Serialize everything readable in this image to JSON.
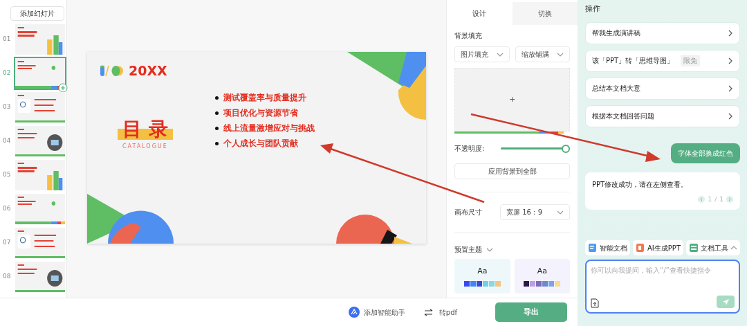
{
  "sidebar": {
    "add_button": "添加幻灯片",
    "slides": [
      {
        "number": "01",
        "selected": false
      },
      {
        "number": "02",
        "selected": true
      },
      {
        "number": "03",
        "selected": false
      },
      {
        "number": "04",
        "selected": false
      },
      {
        "number": "05",
        "selected": false
      },
      {
        "number": "06",
        "selected": false
      },
      {
        "number": "07",
        "selected": false
      },
      {
        "number": "08",
        "selected": false
      }
    ]
  },
  "slide": {
    "year": "20XX",
    "title": "目 录",
    "subtitle": "CATALOGUE",
    "bullets": [
      "测试覆盖率与质量提升",
      "项目优化与资源节省",
      "线上流量激增应对与挑战",
      "个人成长与团队贡献"
    ]
  },
  "design_panel": {
    "tabs": [
      {
        "label": "设计",
        "selected": true
      },
      {
        "label": "切换",
        "selected": false
      }
    ],
    "background_fill": {
      "label": "背景填充",
      "fill_type": "图片填充",
      "fill_mode": "缩放铺满",
      "add": "+"
    },
    "opacity": {
      "label": "不透明度:",
      "level": 1
    },
    "apply_button": "应用背景到全部",
    "canvas_size": {
      "label": "画布尺寸",
      "value": "宽屏 16 : 9"
    },
    "themes": {
      "label": "预置主题",
      "items": [
        {
          "sample": "Aa",
          "swatches": [
            {
              "color": "#3a48f0"
            },
            {
              "color": "#3f86f4"
            },
            {
              "color": "#3a48e0"
            },
            {
              "color": "#6dd3e0"
            },
            {
              "color": "#8dd6df"
            },
            {
              "color": "#f5c583"
            }
          ]
        },
        {
          "sample": "Aa",
          "swatches": [
            {
              "color": "#2a1a4a"
            },
            {
              "color": "#b9a0e6"
            },
            {
              "color": "#7f6bb8"
            },
            {
              "color": "#6a8bd0"
            },
            {
              "color": "#7ea3e6"
            },
            {
              "color": "#f5df8d"
            }
          ]
        }
      ]
    }
  },
  "bottom_bar": {
    "assistant": "添加智能助手",
    "convert": "转pdf",
    "export": "导出"
  },
  "chat": {
    "intro": "操作",
    "suggestions": [
      {
        "text": "帮我生成演讲稿"
      },
      {
        "text": "该「PPT」转「思维导图」",
        "tag": "限免"
      },
      {
        "text": "总结本文档大意"
      },
      {
        "text": "根据本文档回答问题"
      }
    ],
    "user_message": "字体全部换成红色",
    "reply": {
      "text": "PPT修改成功，请在左侧查看。",
      "page": "1",
      "separator": "/",
      "total": "1"
    },
    "tools": [
      {
        "label": "智能文档",
        "kind": "doc"
      },
      {
        "label": "AI生成PPT",
        "kind": "ppt"
      },
      {
        "label": "文档工具",
        "kind": "tools"
      }
    ],
    "input": {
      "placeholder": "你可以向我提问，输入“/”查看快捷指令"
    }
  }
}
